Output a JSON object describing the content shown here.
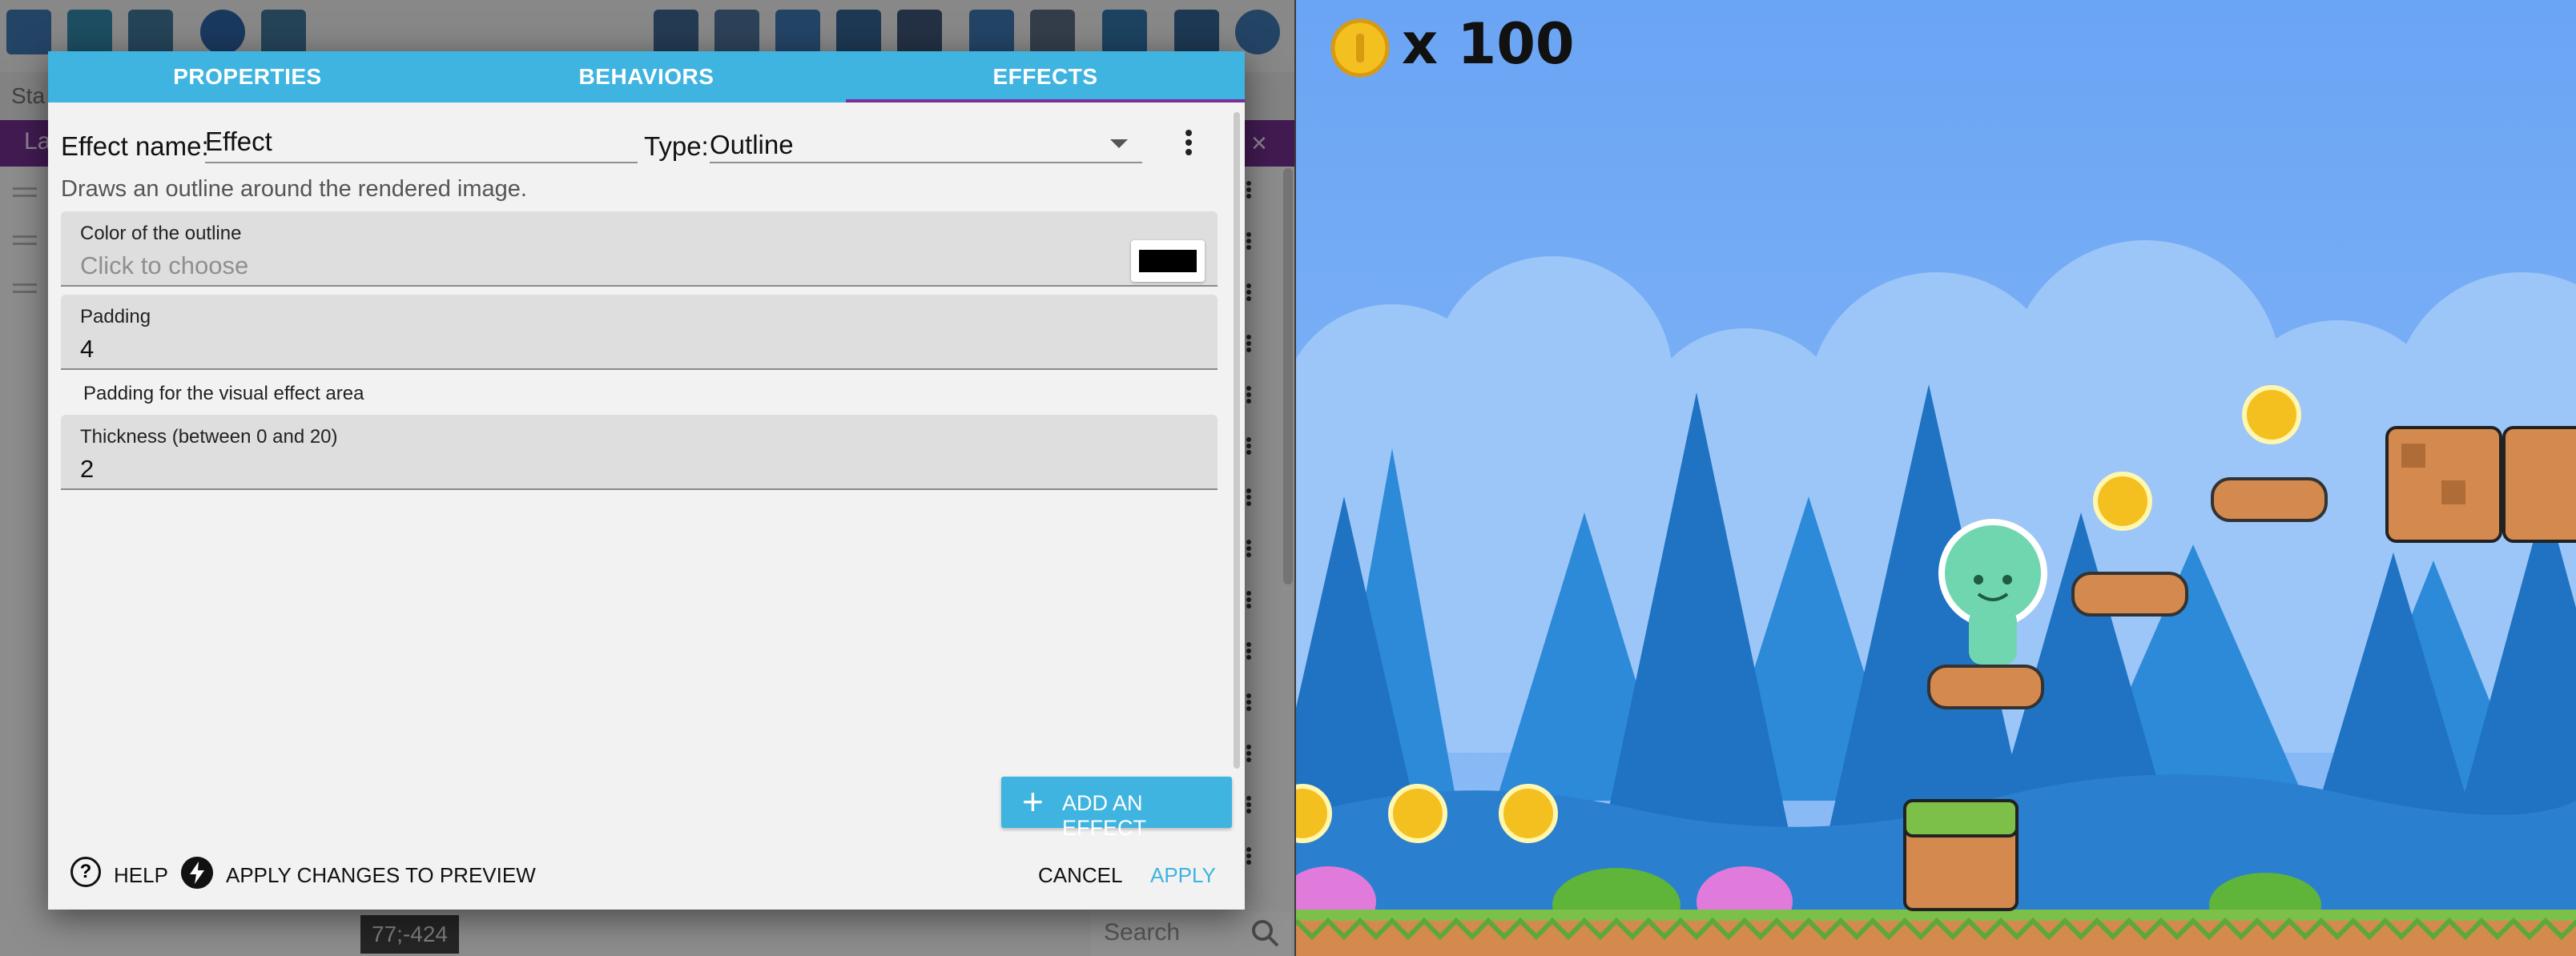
{
  "editor": {
    "status_label": "Sta",
    "layers_label": "La",
    "layers_close": "×",
    "coordinates": "77;-424",
    "search_placeholder": "Search"
  },
  "dialog": {
    "tabs": [
      {
        "label": "PROPERTIES",
        "active": false
      },
      {
        "label": "BEHAVIORS",
        "active": false
      },
      {
        "label": "EFFECTS",
        "active": true
      }
    ],
    "effect_name_label": "Effect name:",
    "effect_name_value": "Effect",
    "type_label": "Type:",
    "type_value": "Outline",
    "description": "Draws an outline around the rendered image.",
    "fields": {
      "color": {
        "label": "Color of the outline",
        "placeholder": "Click to choose",
        "swatch": "#000000"
      },
      "padding": {
        "label": "Padding",
        "value": "4",
        "help": "Padding for the visual effect area"
      },
      "thickness": {
        "label": "Thickness (between 0 and 20)",
        "value": "2"
      }
    },
    "add_effect_label": "ADD AN EFFECT",
    "help_label": "HELP",
    "apply_preview_label": "APPLY CHANGES TO PREVIEW",
    "cancel_label": "CANCEL",
    "apply_label": "APPLY"
  },
  "game": {
    "coin_count": "x 100"
  },
  "colors": {
    "accent": "#3fb4e0",
    "tab_indicator": "#7b2d9a",
    "layers_bar": "#6b2c86",
    "sky": "#6fa8f5",
    "tree_dark": "#1f73c2",
    "tree_light": "#2d8ad8",
    "grass": "#7cc04a",
    "dirt": "#d48a4e"
  }
}
